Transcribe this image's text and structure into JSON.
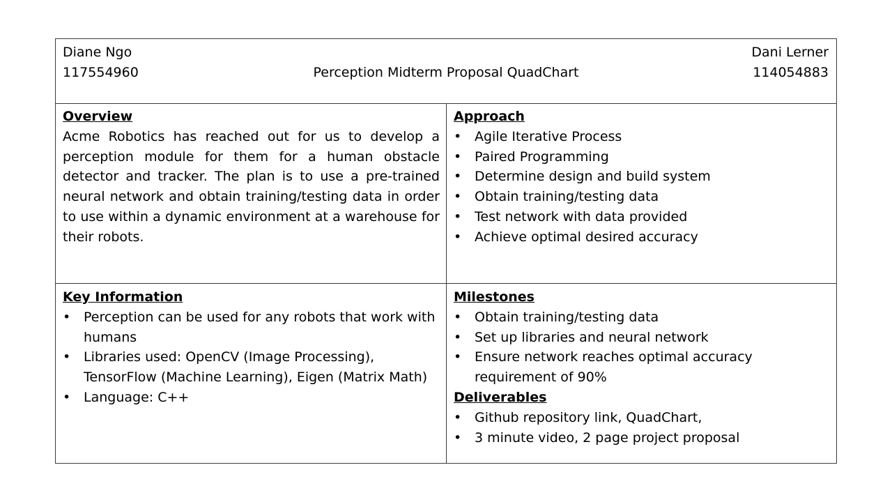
{
  "header": {
    "left_name": "Diane Ngo",
    "left_id": "117554960",
    "title": "Perception Midterm Proposal QuadChart",
    "right_name": "Dani Lerner",
    "right_id": "114054883"
  },
  "overview": {
    "title": "Overview",
    "text": "Acme Robotics has reached out for us to develop a perception module for them for a human obstacle detector and tracker. The plan is to use a pre-trained neural network and obtain training/testing data in order to use within a dynamic environment at a warehouse for their robots."
  },
  "approach": {
    "title": "Approach",
    "items": [
      "Agile Iterative Process",
      "Paired Programming",
      "Determine design and build system",
      "Obtain training/testing data",
      "Test network with data provided",
      "Achieve optimal desired accuracy"
    ]
  },
  "key_information": {
    "title": "Key Information",
    "items": [
      "Perception can be used for any robots that work with humans",
      "Libraries used: OpenCV (Image Processing), TensorFlow (Machine Learning), Eigen (Matrix Math)",
      "Language: C++"
    ]
  },
  "milestones": {
    "title": "Milestones",
    "items": [
      "Obtain training/testing data",
      "Set up libraries and neural network",
      "Ensure network reaches optimal accuracy requirement of 90%"
    ]
  },
  "deliverables": {
    "title": "Deliverables",
    "items": [
      "Github repository link, QuadChart,",
      "3 minute video, 2 page project proposal"
    ]
  },
  "bullet_char": "•"
}
